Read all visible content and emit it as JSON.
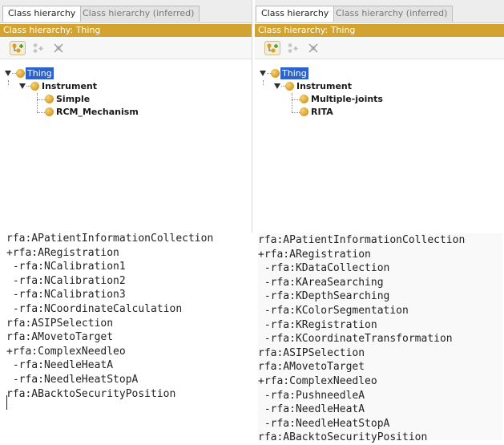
{
  "panels": [
    {
      "tabs": [
        {
          "label": "Class hierarchy"
        },
        {
          "label": "Class hierarchy (inferred)"
        }
      ],
      "title": "Class hierarchy: Thing",
      "tree": {
        "root": "Thing",
        "child": "Instrument",
        "leaves": [
          "Simple",
          "RCM_Mechanism"
        ]
      }
    },
    {
      "tabs": [
        {
          "label": "Class hierarchy"
        },
        {
          "label": "Class hierarchy (inferred)"
        }
      ],
      "title": "Class hierarchy: Thing",
      "tree": {
        "root": "Thing",
        "child": "Instrument",
        "leaves": [
          "Multiple-joints",
          "RITA"
        ]
      }
    }
  ],
  "code": {
    "left": [
      "rfa:APatientInformationCollection",
      "+rfa:ARegistration",
      " -rfa:NCalibration1",
      " -rfa:NCalibration2",
      " -rfa:NCalibration3",
      " -rfa:NCoordinateCalculation",
      "rfa:ASIPSelection",
      "rfa:AMovetoTarget",
      "+rfa:ComplexNeedleo",
      " -rfa:NeedleHeatA",
      " -rfa:NeedleHeatStopA",
      "rfa:ABacktoSecurityPosition"
    ],
    "right": [
      "rfa:APatientInformationCollection",
      "+rfa:ARegistration",
      " -rfa:KDataCollection",
      " -rfa:KAreaSearching",
      " -rfa:KDepthSearching",
      " -rfa:KColorSegmentation",
      " -rfa:KRegistration",
      " -rfa:KCoordinateTransformation",
      "rfa:ASIPSelection",
      "rfa:AMovetoTarget",
      "+rfa:ComplexNeedleo",
      " -rfa:PushneedleA",
      " -rfa:NeedleHeatA",
      " -rfa:NeedleHeatStopA",
      "rfa:ABacktoSecurityPosition"
    ]
  },
  "icons": {
    "toolbar": [
      "add-subclass-icon",
      "add-sibling-icon",
      "delete-class-icon"
    ],
    "accent_color": "#d3a332",
    "selection_color": "#2c62c9"
  }
}
